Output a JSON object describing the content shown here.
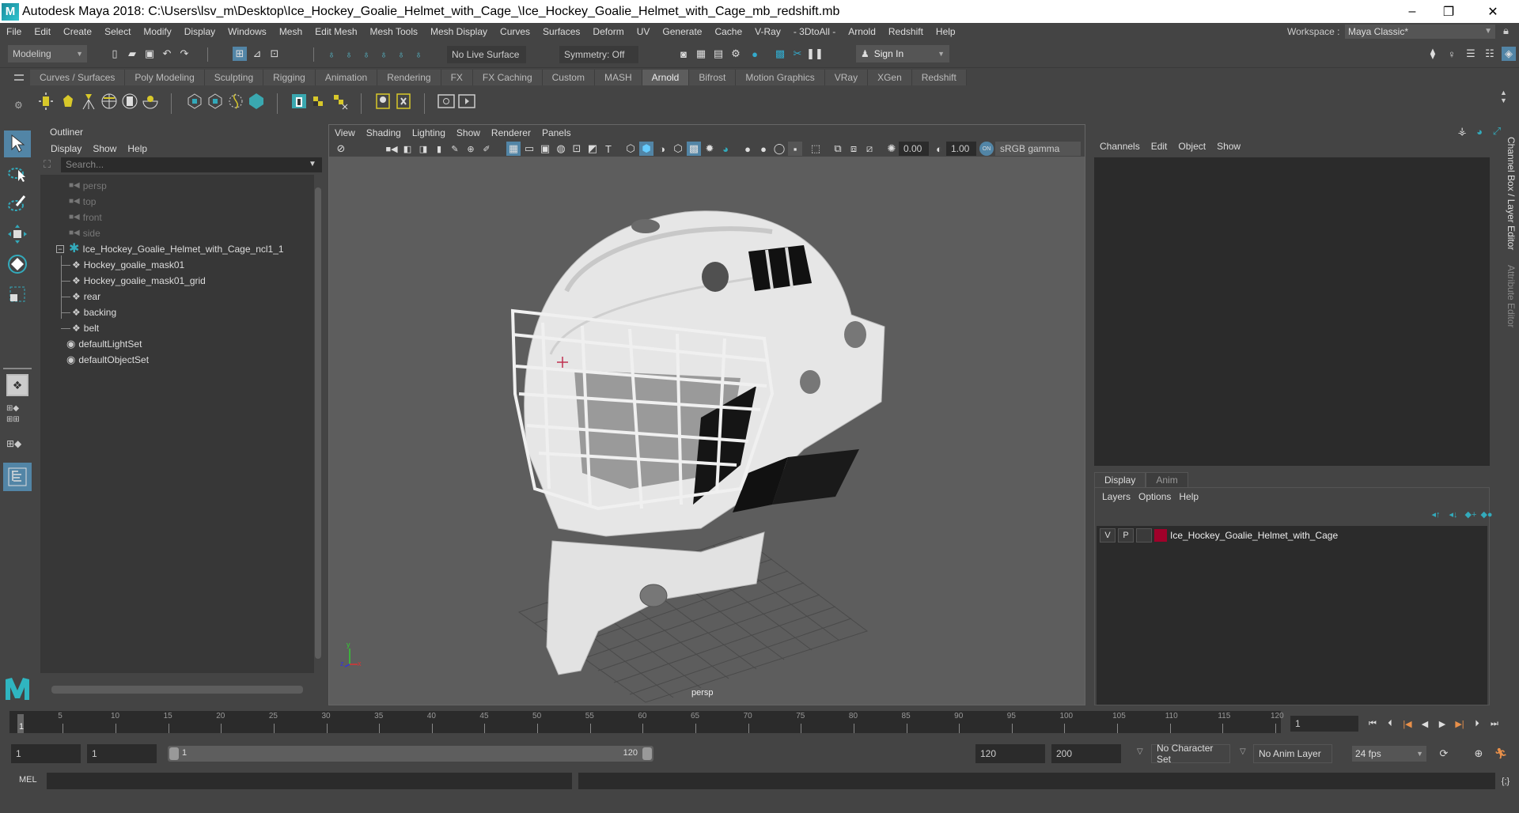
{
  "window": {
    "title": "Autodesk Maya 2018: C:\\Users\\lsv_m\\Desktop\\Ice_Hockey_Goalie_Helmet_with_Cage_\\Ice_Hockey_Goalie_Helmet_with_Cage_mb_redshift.mb",
    "minimize": "–",
    "maximize": "❐",
    "close": "✕"
  },
  "menubar": {
    "items": [
      "File",
      "Edit",
      "Create",
      "Select",
      "Modify",
      "Display",
      "Windows",
      "Mesh",
      "Edit Mesh",
      "Mesh Tools",
      "Mesh Display",
      "Curves",
      "Surfaces",
      "Deform",
      "UV",
      "Generate",
      "Cache",
      "V-Ray",
      "- 3DtoAll -",
      "Arnold",
      "Redshift",
      "Help"
    ],
    "workspace_label": "Workspace :",
    "workspace_value": "Maya Classic*"
  },
  "statusline": {
    "mode": "Modeling",
    "live_surface": "No Live Surface",
    "symmetry": "Symmetry: Off",
    "sign_in": "Sign In"
  },
  "shelf": {
    "tabs": [
      "Curves / Surfaces",
      "Poly Modeling",
      "Sculpting",
      "Rigging",
      "Animation",
      "Rendering",
      "FX",
      "FX Caching",
      "Custom",
      "MASH",
      "Arnold",
      "Bifrost",
      "Motion Graphics",
      "VRay",
      "XGen",
      "Redshift"
    ],
    "active_tab": "Arnold"
  },
  "outliner": {
    "title": "Outliner",
    "menu": [
      "Display",
      "Show",
      "Help"
    ],
    "search_placeholder": "Search...",
    "items": [
      {
        "label": "persp",
        "type": "camera"
      },
      {
        "label": "top",
        "type": "camera"
      },
      {
        "label": "front",
        "type": "camera"
      },
      {
        "label": "side",
        "type": "camera"
      },
      {
        "label": "Ice_Hockey_Goalie_Helmet_with_Cage_ncl1_1",
        "type": "group"
      },
      {
        "label": "Hockey_goalie_mask01",
        "type": "mesh"
      },
      {
        "label": "Hockey_goalie_mask01_grid",
        "type": "mesh"
      },
      {
        "label": "rear",
        "type": "mesh"
      },
      {
        "label": "backing",
        "type": "mesh"
      },
      {
        "label": "belt",
        "type": "mesh"
      },
      {
        "label": "defaultLightSet",
        "type": "set"
      },
      {
        "label": "defaultObjectSet",
        "type": "set"
      }
    ]
  },
  "viewport": {
    "menu": [
      "View",
      "Shading",
      "Lighting",
      "Show",
      "Renderer",
      "Panels"
    ],
    "exposure": "0.00",
    "gamma": "1.00",
    "color_space": "sRGB gamma",
    "camera_label": "persp",
    "axis": {
      "x": "x",
      "y": "y",
      "z": "z"
    }
  },
  "channelbox": {
    "menu": [
      "Channels",
      "Edit",
      "Object",
      "Show"
    ]
  },
  "layereditor": {
    "tabs": [
      "Display",
      "Anim"
    ],
    "active_tab": "Display",
    "menu": [
      "Layers",
      "Options",
      "Help"
    ],
    "layers": [
      {
        "visible": "V",
        "playback": "P",
        "color": "#a0002a",
        "name": "Ice_Hockey_Goalie_Helmet_with_Cage"
      }
    ]
  },
  "side_tabs": [
    "Channel Box / Layer Editor",
    "Attribute Editor"
  ],
  "timeline": {
    "ticks": [
      5,
      10,
      15,
      20,
      25,
      30,
      35,
      40,
      45,
      50,
      55,
      60,
      65,
      70,
      75,
      80,
      85,
      90,
      95,
      100,
      105,
      110,
      115,
      120
    ],
    "range_start": 1,
    "range_end": 120,
    "current_frame": 1,
    "current_frame_field": "1"
  },
  "range": {
    "start_time": "1",
    "playback_start": "1",
    "slider_start": "1",
    "slider_end": "120",
    "playback_end": "120",
    "end_time": "200",
    "character_set": "No Character Set",
    "anim_layer": "No Anim Layer",
    "fps": "24 fps"
  },
  "cmdline": {
    "language": "MEL"
  }
}
